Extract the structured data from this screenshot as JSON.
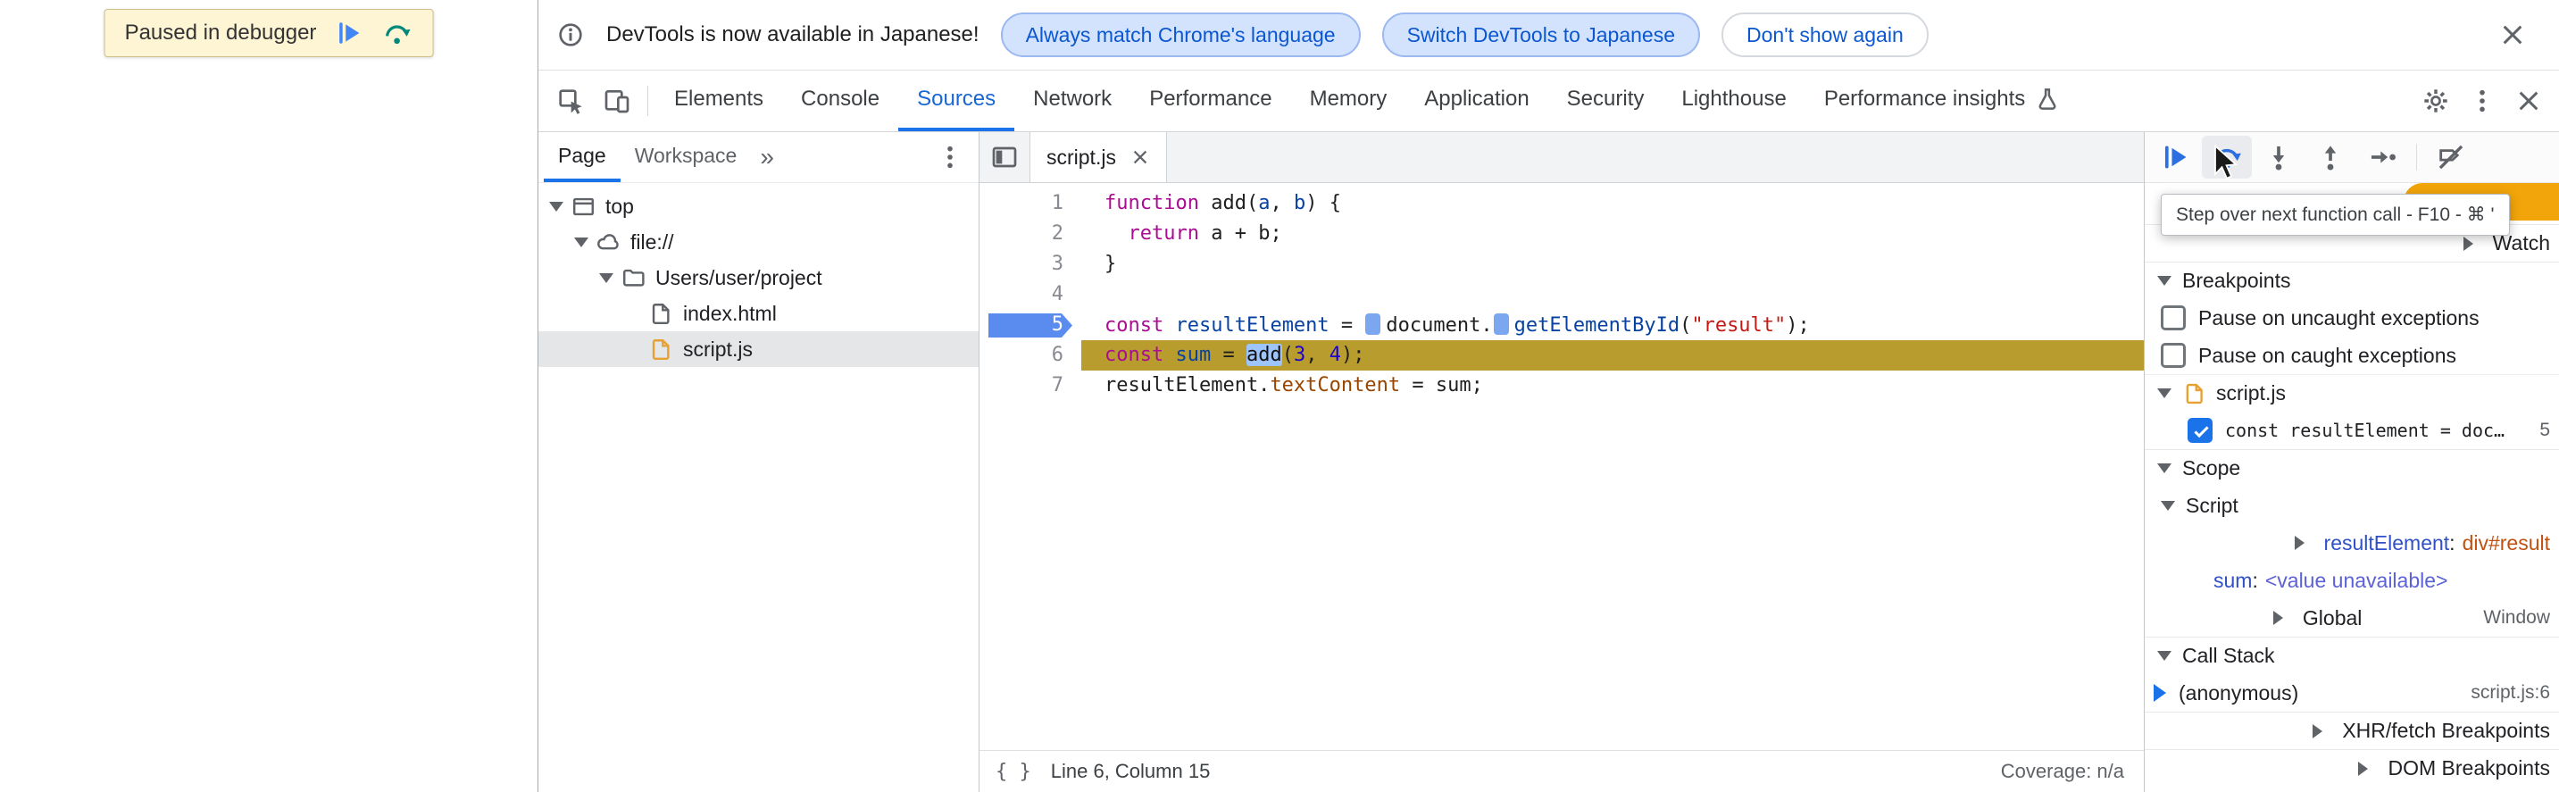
{
  "page": {
    "paused_banner": {
      "label": "Paused in debugger"
    }
  },
  "infobar": {
    "message": "DevTools is now available in Japanese!",
    "action_match": "Always match Chrome's language",
    "action_switch": "Switch DevTools to Japanese",
    "action_dismiss": "Don't show again"
  },
  "main_toolbar": {
    "tabs": [
      "Elements",
      "Console",
      "Sources",
      "Network",
      "Performance",
      "Memory",
      "Application",
      "Security",
      "Lighthouse",
      "Performance insights"
    ],
    "selected_tab": "Sources"
  },
  "navigator": {
    "tabs": [
      "Page",
      "Workspace"
    ],
    "selected_tab": "Page",
    "tree": [
      {
        "label": "top",
        "icon": "frame-icon",
        "depth": 0,
        "expanded": true
      },
      {
        "label": "file://",
        "icon": "cloud-icon",
        "depth": 1,
        "expanded": true
      },
      {
        "label": "Users/user/project",
        "icon": "folder-icon",
        "depth": 2,
        "expanded": true
      },
      {
        "label": "index.html",
        "icon": "file-icon",
        "depth": 3
      },
      {
        "label": "script.js",
        "icon": "js-file-icon",
        "depth": 3,
        "selected": true
      }
    ]
  },
  "editor": {
    "tab": {
      "label": "script.js"
    },
    "breakpoint_lines": [
      5
    ],
    "execution_line": 6,
    "lines": [
      {
        "num": 1,
        "tokens": [
          [
            "kw",
            "function"
          ],
          [
            "pl",
            " add("
          ],
          [
            "def",
            "a"
          ],
          [
            "pl",
            ", "
          ],
          [
            "def",
            "b"
          ],
          [
            "pl",
            ") {"
          ]
        ]
      },
      {
        "num": 2,
        "tokens": [
          [
            "pl",
            "  "
          ],
          [
            "kw",
            "return"
          ],
          [
            "pl",
            " a + b;"
          ]
        ]
      },
      {
        "num": 3,
        "tokens": [
          [
            "pl",
            "}"
          ]
        ]
      },
      {
        "num": 4,
        "tokens": []
      },
      {
        "num": 5,
        "tokens": [
          [
            "kw",
            "const"
          ],
          [
            "pl",
            " "
          ],
          [
            "def",
            "resultElement"
          ],
          [
            "pl",
            " = "
          ],
          [
            "bpm",
            ""
          ],
          [
            "pl",
            "document."
          ],
          [
            "bpm",
            ""
          ],
          [
            "fn",
            "getElementById"
          ],
          [
            "pl",
            "("
          ],
          [
            "str",
            "\"result\""
          ],
          [
            "pl",
            ");"
          ]
        ]
      },
      {
        "num": 6,
        "tokens": [
          [
            "kw",
            "const"
          ],
          [
            "pl",
            " "
          ],
          [
            "def",
            "sum"
          ],
          [
            "pl",
            " = "
          ],
          [
            "sel",
            "add"
          ],
          [
            "pl",
            "("
          ],
          [
            "num",
            "3"
          ],
          [
            "pl",
            ", "
          ],
          [
            "num",
            "4"
          ],
          [
            "pl",
            ");"
          ]
        ]
      },
      {
        "num": 7,
        "tokens": [
          [
            "pl",
            "resultElement."
          ],
          [
            "prop",
            "textContent"
          ],
          [
            "pl",
            " = sum;"
          ]
        ]
      }
    ],
    "status_bar": {
      "position": "Line 6, Column 15",
      "coverage": "Coverage: n/a"
    }
  },
  "debugger": {
    "controls": [
      "resume",
      "step-over",
      "step-into",
      "step-out",
      "step",
      "deactivate-breakpoints"
    ],
    "tooltip": "Step over next function call - F10 - ⌘ '",
    "rows": [
      {
        "type": "header",
        "label": "Watch",
        "expanded": false
      },
      {
        "type": "header",
        "label": "Breakpoints",
        "expanded": true
      },
      {
        "type": "checkbox",
        "label": "Pause on uncaught exceptions",
        "checked": false
      },
      {
        "type": "checkbox",
        "label": "Pause on caught exceptions",
        "checked": false
      },
      {
        "type": "group",
        "label": "script.js",
        "expanded": true
      },
      {
        "type": "breakpoint",
        "label": "const resultElement = doc…",
        "checked": true,
        "line": "5"
      },
      {
        "type": "header",
        "label": "Scope",
        "expanded": true
      },
      {
        "type": "subheader",
        "label": "Script",
        "expanded": true
      },
      {
        "type": "variable",
        "name": "resultElement",
        "value": "div#result",
        "kind": "node",
        "expandable": true
      },
      {
        "type": "variable",
        "name": "sum",
        "value": "<value unavailable>",
        "kind": "unavailable",
        "expandable": false
      },
      {
        "type": "scope-global",
        "label": "Global",
        "right": "Window",
        "expanded": false
      },
      {
        "type": "header",
        "label": "Call Stack",
        "expanded": true
      },
      {
        "type": "frame",
        "label": "(anonymous)",
        "right": "script.js:6",
        "active": true
      },
      {
        "type": "header",
        "label": "XHR/fetch Breakpoints",
        "expanded": false
      },
      {
        "type": "header",
        "label": "DOM Breakpoints",
        "expanded": false
      }
    ]
  }
}
